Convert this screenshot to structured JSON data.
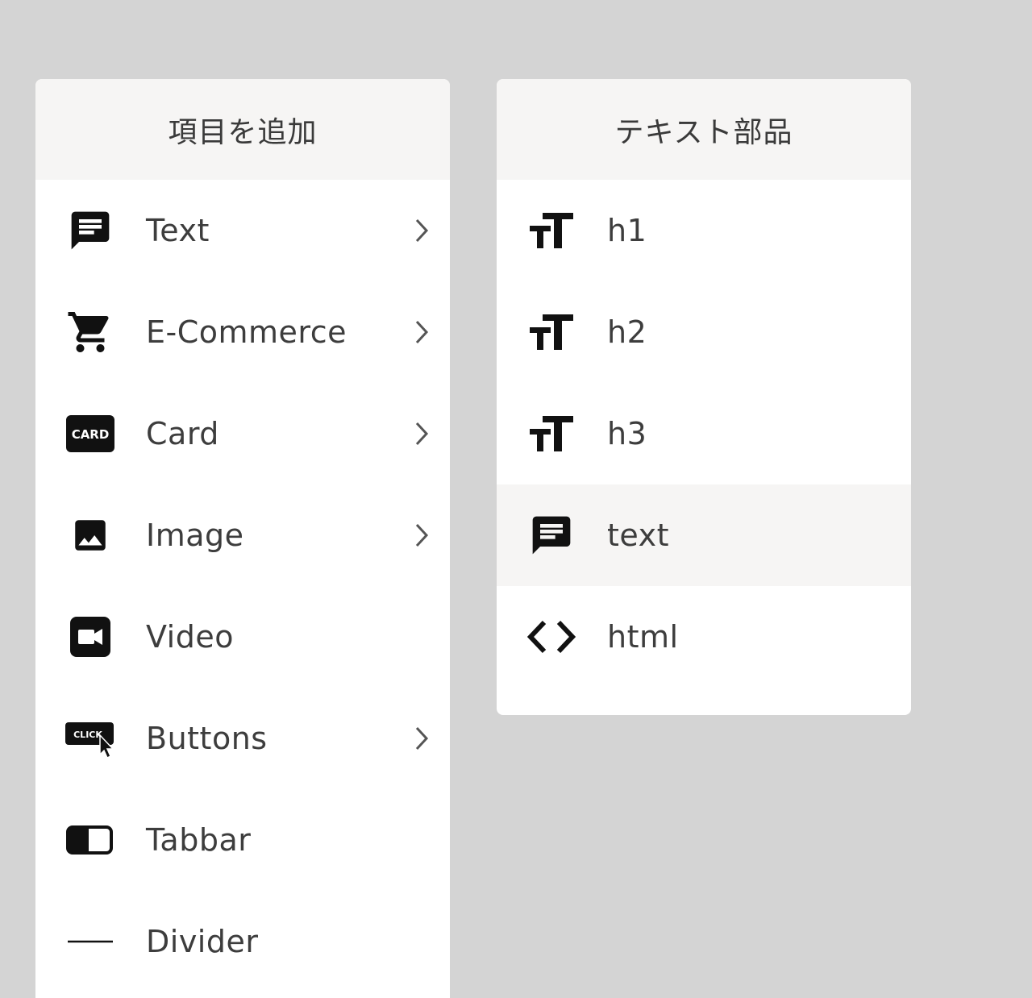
{
  "panels": {
    "add_item": {
      "title": "項目を追加",
      "items": [
        {
          "label": "Text",
          "icon": "message-icon",
          "has_submenu": true
        },
        {
          "label": "E-Commerce",
          "icon": "cart-icon",
          "has_submenu": true
        },
        {
          "label": "Card",
          "icon": "card-icon",
          "icon_text": "CARD",
          "has_submenu": true
        },
        {
          "label": "Image",
          "icon": "image-icon",
          "has_submenu": true
        },
        {
          "label": "Video",
          "icon": "video-icon",
          "has_submenu": false
        },
        {
          "label": "Buttons",
          "icon": "button-icon",
          "icon_text": "CLICK",
          "has_submenu": true
        },
        {
          "label": "Tabbar",
          "icon": "toggle-icon",
          "has_submenu": false
        },
        {
          "label": "Divider",
          "icon": "divider-icon",
          "has_submenu": false
        }
      ]
    },
    "text_parts": {
      "title": "テキスト部品",
      "items": [
        {
          "label": "h1",
          "icon": "text-size-icon"
        },
        {
          "label": "h2",
          "icon": "text-size-icon"
        },
        {
          "label": "h3",
          "icon": "text-size-icon"
        },
        {
          "label": "text",
          "icon": "message-icon",
          "selected": true
        },
        {
          "label": "html",
          "icon": "code-icon"
        }
      ]
    }
  },
  "colors": {
    "background": "#d4d4d4",
    "panel": "#ffffff",
    "header": "#f6f5f4",
    "selected_row": "#f6f5f4",
    "text": "#3d3d3d",
    "icon": "#111111"
  }
}
